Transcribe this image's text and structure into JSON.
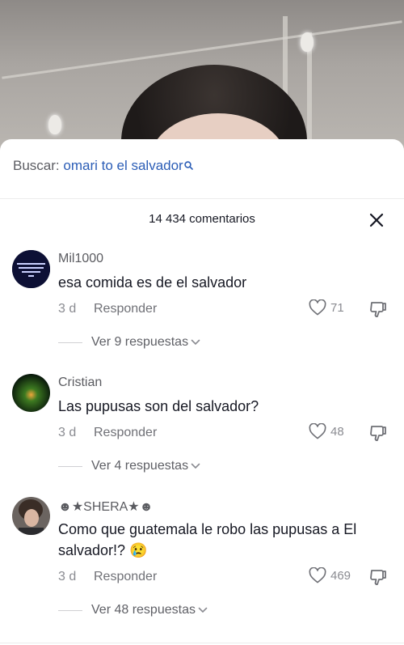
{
  "search": {
    "label": "Buscar:",
    "query": "omari to el salvador"
  },
  "comments_header": {
    "count_text": "14 434 comentarios"
  },
  "comments": [
    {
      "username": "Mil1000",
      "text": "esa comida es de el salvador",
      "age": "3 d",
      "reply_label": "Responder",
      "likes": "71",
      "replies_label": "Ver 9 respuestas"
    },
    {
      "username": "Cristian",
      "text": "Las pupusas son del salvador?",
      "age": "3 d",
      "reply_label": "Responder",
      "likes": "48",
      "replies_label": "Ver 4 respuestas"
    },
    {
      "username": "☻★SHERA★☻",
      "text": "Como que guatemala le robo las pupusas a El salvador!? 😢",
      "age": "3 d",
      "reply_label": "Responder",
      "likes": "469",
      "replies_label": "Ver 48 respuestas"
    }
  ],
  "colors": {
    "accent_link": "#2b5db6",
    "text_primary": "#161823",
    "text_secondary": "#8a8b91"
  },
  "icons": [
    "search-icon",
    "close-icon",
    "heart-icon",
    "dislike-icon",
    "chevron-down-icon"
  ]
}
